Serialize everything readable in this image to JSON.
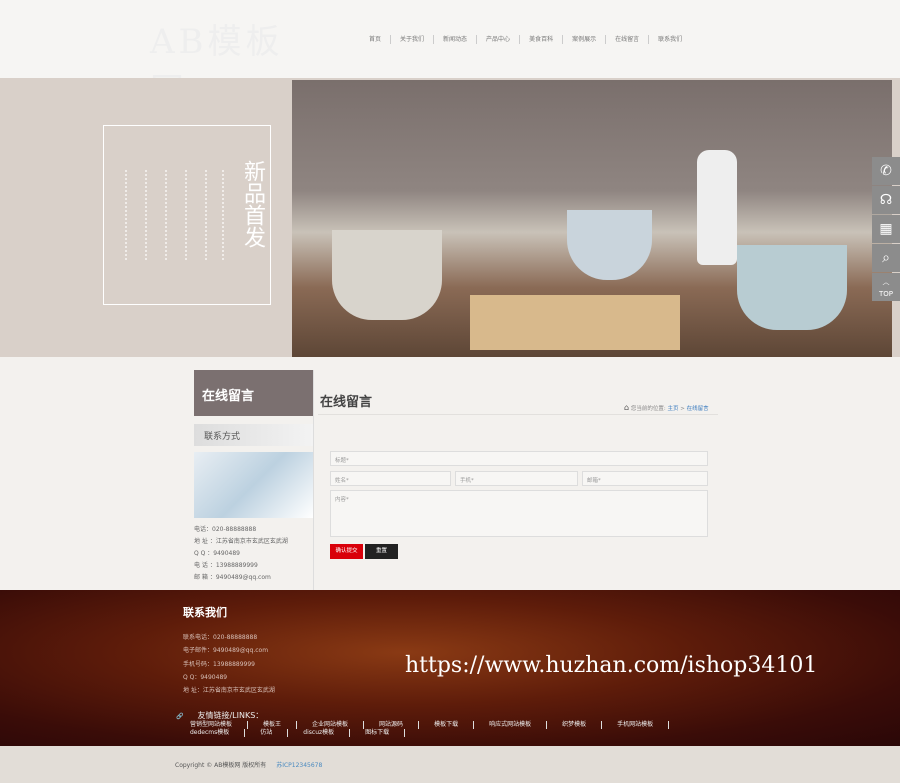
{
  "header": {
    "logo": "AB模板网",
    "nav": [
      "首页",
      "关于我们",
      "新闻动态",
      "产品中心",
      "美食百科",
      "案例展示",
      "在线留言",
      "联系我们"
    ]
  },
  "banner": {
    "title": "新品首发"
  },
  "float_icons": [
    "phone-icon",
    "headset-icon",
    "qrcode-icon",
    "search-icon",
    "top-icon"
  ],
  "float_top_label": "TOP",
  "sidebar": {
    "title": "在线留言",
    "subtitle": "联系方式",
    "contact": [
      "电话：020-88888888",
      "地 址 ：江苏省南京市玄武区玄武湖",
      "Q Q ：9490489",
      "电 话 ：13988889999",
      "邮 箱 ：9490489@qq.com"
    ]
  },
  "main": {
    "title": "在线留言",
    "breadcrumb": {
      "label": "您当前的位置:",
      "home": "主页",
      "sep": ">",
      "current": "在线留言"
    },
    "form": {
      "title_placeholder": "标题*",
      "name_placeholder": "姓名*",
      "phone_placeholder": "手机*",
      "email_placeholder": "邮箱*",
      "content_placeholder": "内容*",
      "submit": "确认提交",
      "reset": "重置"
    }
  },
  "footer": {
    "title": "联系我们",
    "contact": [
      "联系电话：020-88888888",
      "电子邮件：9490489@qq.com",
      "手机号码：13988889999",
      "Q Q：9490489",
      "地 址：江苏省南京市玄武区玄武湖"
    ],
    "links_title": "友情链接/LINKS：",
    "links": [
      "营销型网站模板",
      "模板王",
      "企业网站模板",
      "网站源码",
      "模板下载",
      "响应式网站模板",
      "织梦模板",
      "手机网站模板",
      "dedecms模板",
      "仿站",
      "discuz模板",
      "图标下载"
    ],
    "watermark": "https://www.huzhan.com/ishop34101"
  },
  "copyright": {
    "text": "Copyright © AB模板网 版权所有",
    "icp": "苏ICP12345678"
  }
}
